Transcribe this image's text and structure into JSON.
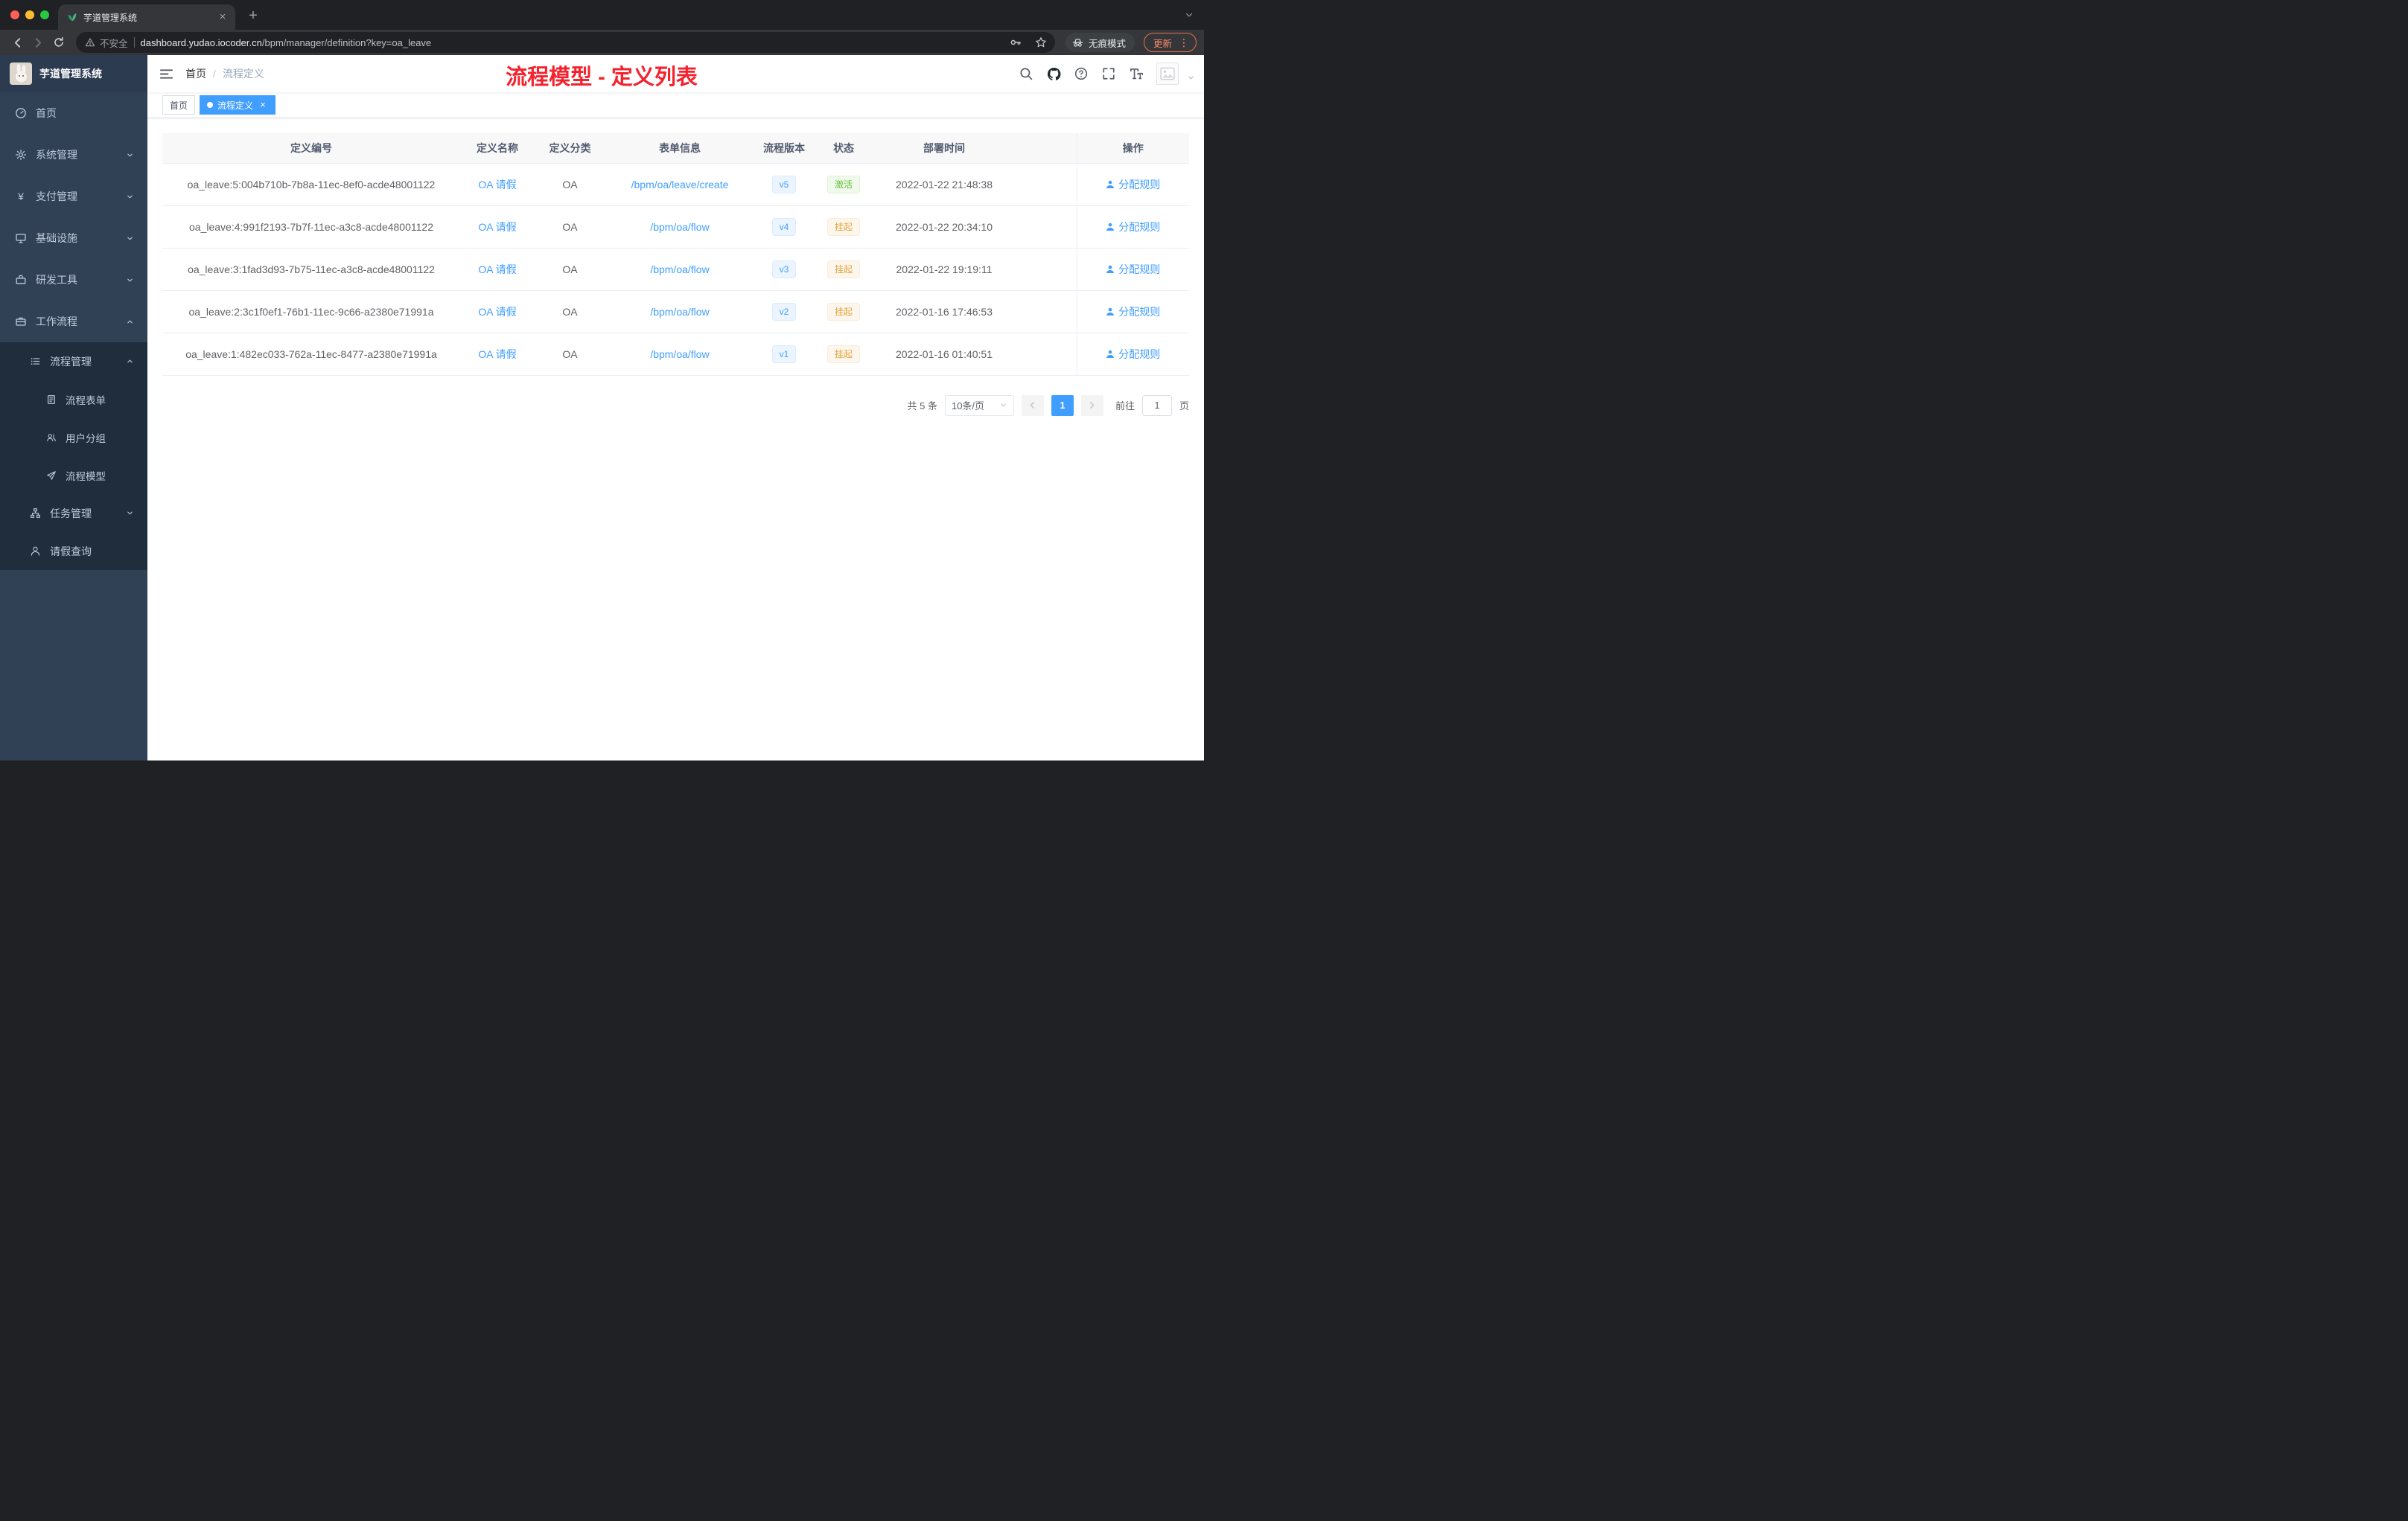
{
  "browser": {
    "tab_title": "芋道管理系统",
    "security_label": "不安全",
    "url_host": "dashboard.yudao.iocoder.cn",
    "url_path": "/bpm/manager/definition?key=oa_leave",
    "incognito_label": "无痕模式",
    "update_label": "更新"
  },
  "sidebar": {
    "title": "芋道管理系统",
    "menu": [
      {
        "label": "首页"
      },
      {
        "label": "系统管理"
      },
      {
        "label": "支付管理"
      },
      {
        "label": "基础设施"
      },
      {
        "label": "研发工具"
      },
      {
        "label": "工作流程"
      },
      {
        "label": "流程管理"
      },
      {
        "label": "流程表单"
      },
      {
        "label": "用户分组"
      },
      {
        "label": "流程模型"
      },
      {
        "label": "任务管理"
      },
      {
        "label": "请假查询"
      }
    ]
  },
  "header": {
    "breadcrumb_home": "首页",
    "breadcrumb_current": "流程定义",
    "annotation": "流程模型 - 定义列表"
  },
  "tags": {
    "home": "首页",
    "current": "流程定义"
  },
  "table": {
    "columns": [
      "定义编号",
      "定义名称",
      "定义分类",
      "表单信息",
      "流程版本",
      "状态",
      "部署时间",
      "操作"
    ],
    "rows": [
      {
        "id": "oa_leave:5:004b710b-7b8a-11ec-8ef0-acde48001122",
        "name": "OA 请假",
        "category": "OA",
        "form": "/bpm/oa/leave/create",
        "version": "v5",
        "status": "激活",
        "deploy_time": "2022-01-22 21:48:38",
        "action": "分配规则"
      },
      {
        "id": "oa_leave:4:991f2193-7b7f-11ec-a3c8-acde48001122",
        "name": "OA 请假",
        "category": "OA",
        "form": "/bpm/oa/flow",
        "version": "v4",
        "status": "挂起",
        "deploy_time": "2022-01-22 20:34:10",
        "action": "分配规则"
      },
      {
        "id": "oa_leave:3:1fad3d93-7b75-11ec-a3c8-acde48001122",
        "name": "OA 请假",
        "category": "OA",
        "form": "/bpm/oa/flow",
        "version": "v3",
        "status": "挂起",
        "deploy_time": "2022-01-22 19:19:11",
        "action": "分配规则"
      },
      {
        "id": "oa_leave:2:3c1f0ef1-76b1-11ec-9c66-a2380e71991a",
        "name": "OA 请假",
        "category": "OA",
        "form": "/bpm/oa/flow",
        "version": "v2",
        "status": "挂起",
        "deploy_time": "2022-01-16 17:46:53",
        "action": "分配规则"
      },
      {
        "id": "oa_leave:1:482ec033-762a-11ec-8477-a2380e71991a",
        "name": "OA 请假",
        "category": "OA",
        "form": "/bpm/oa/flow",
        "version": "v1",
        "status": "挂起",
        "deploy_time": "2022-01-16 01:40:51",
        "action": "分配规则"
      }
    ]
  },
  "pagination": {
    "total": "共 5 条",
    "page_size": "10条/页",
    "page": "1",
    "goto_label": "前往",
    "goto_value": "1",
    "page_unit": "页"
  },
  "icons": {
    "tab_close": "×",
    "tag_close": "×",
    "new_tab": "+",
    "more_vertical": "⋮",
    "breadcrumb_separator": "/",
    "yen": "¥"
  },
  "colors": {
    "primary": "#409eff",
    "success": "#67c23a",
    "warning": "#e6a23c",
    "annotation_red": "#f5222d",
    "sidebar_bg": "#304156",
    "submenu_bg": "#1f2d3d"
  }
}
